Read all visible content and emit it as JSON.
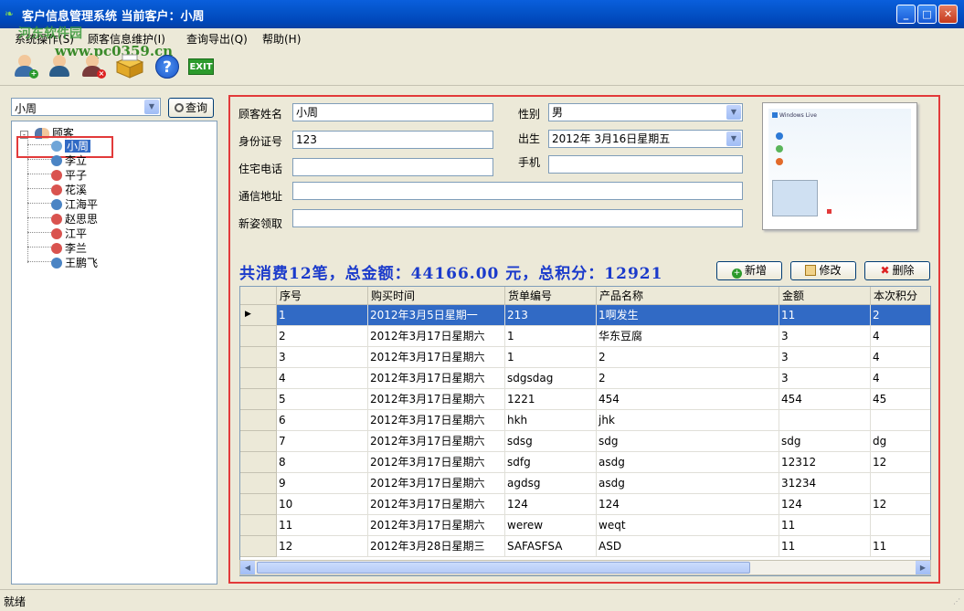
{
  "window": {
    "title": "客户信息管理系统  当前客户：小周"
  },
  "watermark": {
    "line1": "河东软件园",
    "line2": "www.pc0359.cn"
  },
  "menu": {
    "items": [
      "系统操作(S)",
      "顾客信息维护(I)",
      "查询导出(Q)",
      "帮助(H)"
    ]
  },
  "toolbar": {
    "exit_label": "EXIT"
  },
  "left": {
    "combo_value": "小周",
    "search_label": "查询",
    "tree_root": "顾客",
    "customers": [
      "小周",
      "李立",
      "平子",
      "花溪",
      "江海平",
      "赵思思",
      "江平",
      "李兰",
      "王鹏飞"
    ]
  },
  "form": {
    "name_label": "顾客姓名",
    "name_value": "小周",
    "gender_label": "性别",
    "gender_value": "男",
    "id_label": "身份证号",
    "id_value": "123",
    "birth_label": "出生",
    "birth_value": "2012年 3月16日星期五",
    "home_phone_label": "住宅电话",
    "home_phone_value": "",
    "mobile_label": "手机",
    "mobile_value": "",
    "address_label": "通信地址",
    "address_value": "",
    "gift_label": "新姿领取",
    "gift_value": "",
    "photo_caption": "Windows Live"
  },
  "summary": {
    "text": "共消费12笔，总金额：44166.00 元，总积分：12921"
  },
  "actions": {
    "add": "新增",
    "edit": "修改",
    "delete": "删除"
  },
  "grid": {
    "columns": [
      "序号",
      "购买时间",
      "货单编号",
      "产品名称",
      "金额",
      "本次积分"
    ],
    "rows": [
      [
        "1",
        "2012年3月5日星期一",
        "213",
        "1啊发生",
        "11",
        "2"
      ],
      [
        "2",
        "2012年3月17日星期六",
        "1",
        "华东豆腐",
        "3",
        "4"
      ],
      [
        "3",
        "2012年3月17日星期六",
        "1",
        "2",
        "3",
        "4"
      ],
      [
        "4",
        "2012年3月17日星期六",
        "sdgsdag",
        "2",
        "3",
        "4"
      ],
      [
        "5",
        "2012年3月17日星期六",
        "1221",
        "454",
        "454",
        "45"
      ],
      [
        "6",
        "2012年3月17日星期六",
        "hkh",
        "jhk",
        "",
        ""
      ],
      [
        "7",
        "2012年3月17日星期六",
        "sdsg",
        "sdg",
        "sdg",
        "dg"
      ],
      [
        "8",
        "2012年3月17日星期六",
        "sdfg",
        "asdg",
        "12312",
        "12"
      ],
      [
        "9",
        "2012年3月17日星期六",
        "agdsg",
        "asdg",
        "31234",
        ""
      ],
      [
        "10",
        "2012年3月17日星期六",
        "124",
        "124",
        "124",
        "12"
      ],
      [
        "11",
        "2012年3月17日星期六",
        "werew",
        "weqt",
        "11",
        ""
      ],
      [
        "12",
        "2012年3月28日星期三",
        "SAFASFSA",
        "ASD",
        "11",
        "11"
      ]
    ],
    "selected_row": 0
  },
  "status": {
    "text": "就绪"
  },
  "colors": {
    "selected_row": "#316ac5",
    "highlight_border": "#e23a3a",
    "summary_text": "#1a3acb"
  }
}
